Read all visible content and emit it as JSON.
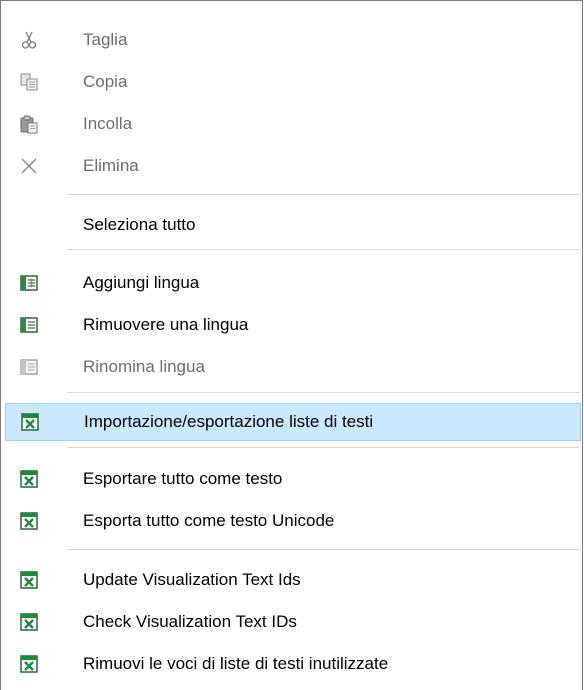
{
  "context_menu": {
    "items": [
      {
        "label": "Taglia",
        "icon": "scissors-icon",
        "enabled": false
      },
      {
        "label": "Copia",
        "icon": "copy-icon",
        "enabled": false
      },
      {
        "label": "Incolla",
        "icon": "paste-icon",
        "enabled": false
      },
      {
        "label": "Elimina",
        "icon": "delete-x-icon",
        "enabled": false
      },
      {
        "label": "Seleziona tutto",
        "icon": "",
        "enabled": true
      },
      {
        "label": "Aggiungi lingua",
        "icon": "language-add-icon",
        "enabled": true
      },
      {
        "label": "Rimuovere una lingua",
        "icon": "language-remove-icon",
        "enabled": true
      },
      {
        "label": "Rinomina lingua",
        "icon": "language-rename-icon",
        "enabled": false
      },
      {
        "label": "Importazione/esportazione liste di testi",
        "icon": "excel-icon",
        "enabled": true,
        "highlighted": true
      },
      {
        "label": "Esportare tutto come testo",
        "icon": "excel-icon",
        "enabled": true
      },
      {
        "label": "Esporta tutto come testo Unicode",
        "icon": "excel-icon",
        "enabled": true
      },
      {
        "label": "Update Visualization Text Ids",
        "icon": "excel-icon",
        "enabled": true
      },
      {
        "label": "Check Visualization Text IDs",
        "icon": "excel-icon",
        "enabled": true
      },
      {
        "label": "Rimuovi le voci di liste di testi inutilizzate",
        "icon": "excel-icon",
        "enabled": true
      }
    ]
  },
  "colors": {
    "highlight_background": "#cce8ff",
    "highlight_border": "#99d1ff",
    "disabled_text": "#6d6d6d",
    "excel_green": "#1d8a3a"
  }
}
